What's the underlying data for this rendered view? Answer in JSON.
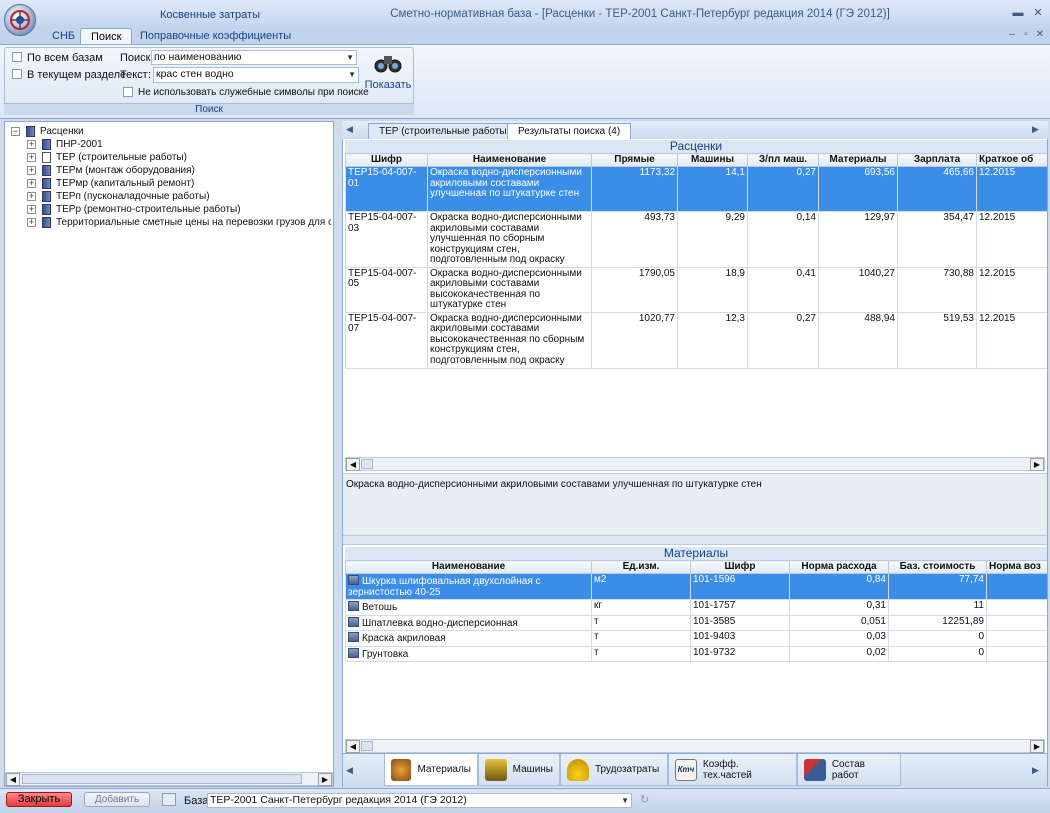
{
  "window": {
    "qat_label": "Косвенные затраты",
    "title": "Сметно-нормативная база - [Расценки - ТЕР-2001 Санкт-Петербург редакция 2014 (ГЭ 2012)]",
    "minimize": "▬",
    "maximize": "▫",
    "close": "✕"
  },
  "ribbon": {
    "tabs": [
      "СНБ",
      "Поиск",
      "Поправочные коэффициенты"
    ],
    "active_tab": "Поиск",
    "group_label": "Поиск",
    "chk_all_bases": "По всем базам",
    "chk_current_section": "В текущем разделе",
    "search_label": "Поиск:",
    "search_mode": "по наименованию",
    "text_label": "Текст",
    "text_colon": ":",
    "text_value": "крас стен водно",
    "chk_no_special": "Не использовать служебные символы при поиске",
    "show_button": "Показать"
  },
  "tree": {
    "root": "Расценки",
    "items": [
      "ПНР-2001",
      "ТЕР (строительные работы)",
      "ТЕРм (монтаж оборудования)",
      "ТЕРмр (капитальный ремонт)",
      "ТЕРп (пусконаладочные работы)",
      "ТЕРр (ремонтно-строительные работы)",
      "Территориальные сметные цены на перевозки грузов для строит"
    ]
  },
  "doc_tabs": [
    "ТЕР (строительные работы)",
    "Результаты поиска (4)"
  ],
  "rates": {
    "title": "Расценки",
    "columns": [
      "Шифр",
      "Наименование",
      "Прямые",
      "Машины",
      "З/пл маш.",
      "Материалы",
      "Зарплата",
      "Краткое об"
    ],
    "rows": [
      {
        "code": "ТЕР15-04-007-01",
        "name": "Окраска водно-дисперсионными акриловыми составами улучшенная по штукатурке стен",
        "direct": "1173,32",
        "machines": "14,1",
        "wage_mach": "0,27",
        "materials": "693,56",
        "wage": "465,66",
        "brief": "12.2015"
      },
      {
        "code": "ТЕР15-04-007-03",
        "name": "Окраска водно-дисперсионными акриловыми составами улучшенная по сборным конструкциям стен, подготовленным под окраску",
        "direct": "493,73",
        "machines": "9,29",
        "wage_mach": "0,14",
        "materials": "129,97",
        "wage": "354,47",
        "brief": "12.2015"
      },
      {
        "code": "ТЕР15-04-007-05",
        "name": "Окраска водно-дисперсионными акриловыми составами высококачественная по штукатурке стен",
        "direct": "1790,05",
        "machines": "18,9",
        "wage_mach": "0,41",
        "materials": "1040,27",
        "wage": "730,88",
        "brief": "12.2015"
      },
      {
        "code": "ТЕР15-04-007-07",
        "name": "Окраска водно-дисперсионными акриловыми составами высококачественная по сборным конструкциям стен, подготовленным под окраску",
        "direct": "1020,77",
        "machines": "12,3",
        "wage_mach": "0,27",
        "materials": "488,94",
        "wage": "519,53",
        "brief": "12.2015"
      }
    ]
  },
  "description": "Окраска водно-дисперсионными акриловыми составами улучшенная по штукатурке стен",
  "materials": {
    "title": "Материалы",
    "columns": [
      "Наименование",
      "Ед.изм.",
      "Шифр",
      "Норма расхода",
      "Баз. стоимость",
      "Норма воз"
    ],
    "rows": [
      {
        "name": "Шкурка шлифовальная двухслойная с зернистостью 40-25",
        "unit": "м2",
        "code": "101-1596",
        "norm": "0,84",
        "cost": "77,74"
      },
      {
        "name": "Ветошь",
        "unit": "кг",
        "code": "101-1757",
        "norm": "0,31",
        "cost": "11"
      },
      {
        "name": "Шпатлевка водно-дисперсионная",
        "unit": "т",
        "code": "101-3585",
        "norm": "0,051",
        "cost": "12251,89"
      },
      {
        "name": "Краска акриловая",
        "unit": "т",
        "code": "101-9403",
        "norm": "0,03",
        "cost": "0"
      },
      {
        "name": "Грунтовка",
        "unit": "т",
        "code": "101-9732",
        "norm": "0,02",
        "cost": "0"
      }
    ]
  },
  "bottom_tabs": [
    "Материалы",
    "Машины",
    "Трудозатраты",
    "Коэфф. тех.частей",
    "Состав работ"
  ],
  "coef_icon_text": "Ктч",
  "status": {
    "close_button": "Закрыть",
    "add_button": "Добавить",
    "base_label": "База:",
    "base_value": "ТЕР-2001 Санкт-Петербург редакция 2014 (ГЭ 2012)"
  },
  "colors": {
    "selection": "#3b8ee8",
    "accent": "#15428b"
  }
}
